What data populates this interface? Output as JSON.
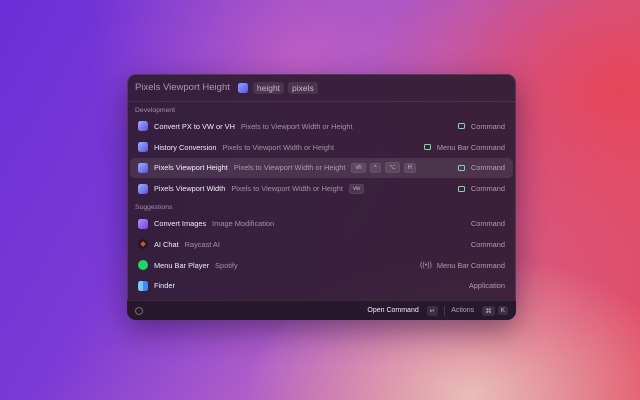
{
  "search": {
    "text": "Pixels Viewport Height",
    "icon": "pixels-viewport-command-icon",
    "arguments": [
      "height",
      "pixels"
    ]
  },
  "sections": {
    "development": "Development",
    "suggestions": "Suggestions"
  },
  "development": [
    {
      "title": "Convert PX to VW or VH",
      "subtitle": "Pixels to Viewport Width or Height",
      "accessory": "Command",
      "icon": "pixels-icon"
    },
    {
      "title": "History Conversion",
      "subtitle": "Pixels to Viewport Width or Height",
      "accessory": "Menu Bar Command",
      "icon": "pixels-icon"
    },
    {
      "title": "Pixels Viewport Height",
      "subtitle": "Pixels to Viewport Width or Height",
      "alias": "vh",
      "hotkey": [
        "^",
        "⌥",
        "H"
      ],
      "accessory": "Command",
      "icon": "pixels-icon",
      "selected": true
    },
    {
      "title": "Pixels Viewport Width",
      "subtitle": "Pixels to Viewport Width or Height",
      "alias": "vw",
      "accessory": "Command",
      "icon": "pixels-icon"
    }
  ],
  "suggestions": [
    {
      "title": "Convert Images",
      "subtitle": "Image Modification",
      "accessory": "Command",
      "icon": "image-icon"
    },
    {
      "title": "AI Chat",
      "subtitle": "Raycast AI",
      "accessory": "Command",
      "icon": "raycast-ai-icon"
    },
    {
      "title": "Menu Bar Player",
      "subtitle": "Spotify",
      "accessory": "Menu Bar Command",
      "icon": "spotify-icon"
    },
    {
      "title": "Finder",
      "subtitle": "",
      "accessory": "Application",
      "icon": "finder-icon"
    }
  ],
  "footer": {
    "primary_action": "Open Command",
    "primary_key": "↵",
    "actions_label": "Actions",
    "actions_keys": [
      "⌘",
      "K"
    ]
  }
}
